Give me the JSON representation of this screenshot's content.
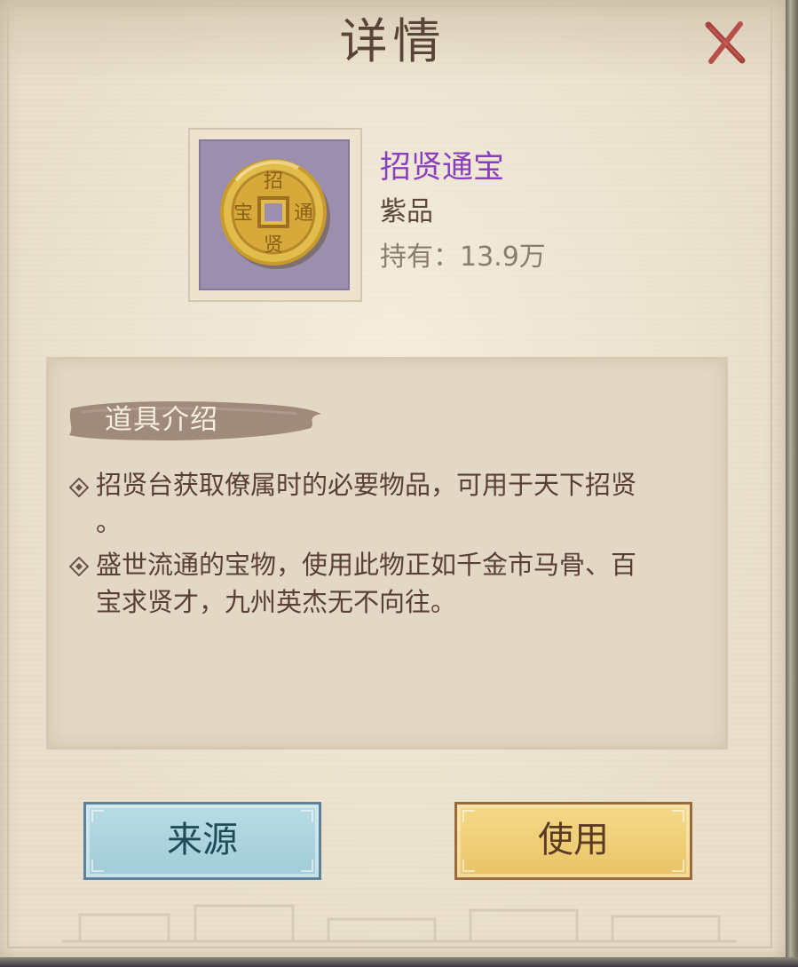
{
  "dialog": {
    "title": "详情",
    "close_icon": "close-x-icon"
  },
  "item": {
    "icon": "copper-coin-icon",
    "name": "招贤通宝",
    "name_color": "#8a3fbf",
    "grade": "紫品",
    "owned": "持有：13.9万"
  },
  "description": {
    "header": "道具介绍",
    "lines": [
      "招贤台获取僚属时的必要物品，可用于天下招贤",
      "。",
      "盛世流通的宝物，使用此物正如千金市马骨、百",
      "宝求贤才，九州英杰无不向往。"
    ]
  },
  "buttons": {
    "source_label": "来源",
    "use_label": "使用"
  }
}
